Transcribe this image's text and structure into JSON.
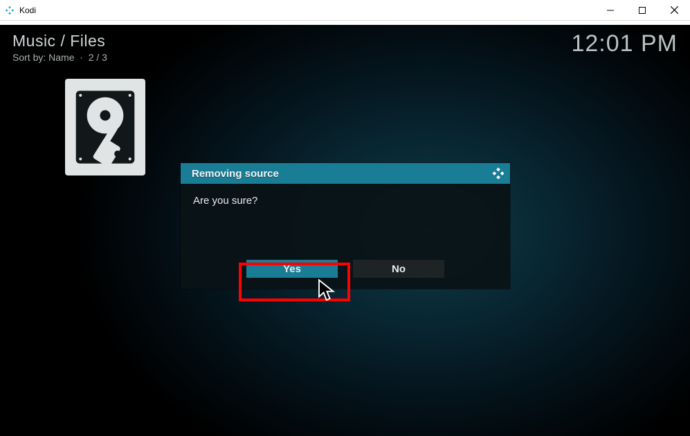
{
  "window": {
    "title": "Kodi"
  },
  "header": {
    "breadcrumb": "Music / Files",
    "sort_label": "Sort by: Name",
    "position": "2 / 3"
  },
  "clock": "12:01 PM",
  "dialog": {
    "title": "Removing source",
    "message": "Are you sure?",
    "yes_label": "Yes",
    "no_label": "No"
  },
  "icons": {
    "kodi": "kodi-logo",
    "drive": "hard-drive-icon"
  }
}
